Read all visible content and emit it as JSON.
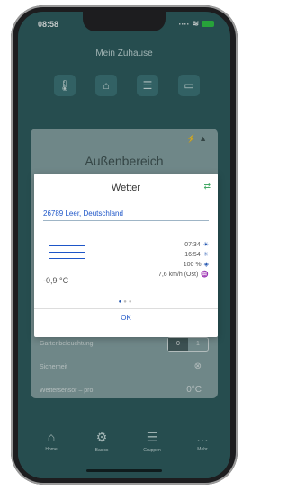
{
  "status_bar": {
    "time": "08:58"
  },
  "app_header": {
    "title": "Mein Zuhause"
  },
  "background_panel": {
    "title": "Außenbereich",
    "rows": [
      {
        "label": "Gartenbeleuchtung",
        "control": "0 | 1",
        "on_text": "0",
        "off_text": "1"
      },
      {
        "label": "Sicherheit",
        "control": "⊗"
      },
      {
        "label": "Wettersensor – pro",
        "value": "0°C"
      }
    ]
  },
  "dialog": {
    "title": "Wetter",
    "location": "26789 Leer, Deutschland",
    "temperature": "-0,9 °C",
    "details": [
      {
        "text": "07:34",
        "icon": "sunrise-icon"
      },
      {
        "text": "16:54",
        "icon": "sunset-icon"
      },
      {
        "text": "100 %",
        "icon": "humidity-icon"
      },
      {
        "text": "7,6 km/h (Ost)",
        "icon": "wind-icon"
      }
    ],
    "ok_label": "OK"
  },
  "tabs": [
    {
      "label": "Home",
      "icon": "home-icon"
    },
    {
      "label": "Basics",
      "icon": "gear-icon"
    },
    {
      "label": "Gruppen",
      "icon": "groups-icon"
    },
    {
      "label": "Mehr",
      "icon": "more-icon"
    }
  ]
}
